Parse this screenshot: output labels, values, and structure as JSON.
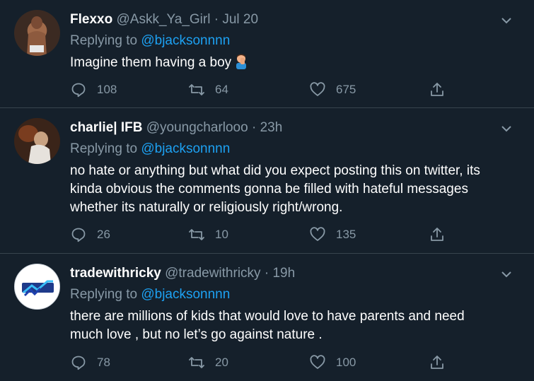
{
  "tweets": [
    {
      "name": "Flexxo",
      "handle": "@Askk_Ya_Girl",
      "separator": "·",
      "time": "Jul 20",
      "replying_prefix": "Replying to",
      "replying_to": "@bjacksonnnn",
      "text_lines": [
        "Imagine them having a boy"
      ],
      "emoji": "man-facepalming-emoji",
      "replies": "108",
      "retweets": "64",
      "likes": "675"
    },
    {
      "name": "charlie| IFB",
      "handle": "@youngcharlooo",
      "separator": "·",
      "time": "23h",
      "replying_prefix": "Replying to",
      "replying_to": "@bjacksonnnn",
      "text_lines": [
        "no hate or anything but what did you expect posting this on twitter, its",
        "kinda obvious the comments gonna be filled with hateful messages",
        "whether its naturally or religiously right/wrong."
      ],
      "replies": "26",
      "retweets": "10",
      "likes": "135"
    },
    {
      "name": "tradewithricky",
      "handle": "@tradewithricky",
      "separator": "·",
      "time": "19h",
      "replying_prefix": "Replying to",
      "replying_to": "@bjacksonnnn",
      "text_lines": [
        "there are millions of kids that would love to have parents and need",
        "much love , but no let’s go against nature ."
      ],
      "replies": "78",
      "retweets": "20",
      "likes": "100"
    }
  ],
  "icons": {
    "reply": "reply-icon",
    "retweet": "retweet-icon",
    "like": "heart-icon",
    "share": "share-icon",
    "menu": "chevron-down-icon"
  },
  "colors": {
    "background": "#15202b",
    "muted": "#8899a6",
    "link": "#1da1f2",
    "divider": "#38444d"
  }
}
